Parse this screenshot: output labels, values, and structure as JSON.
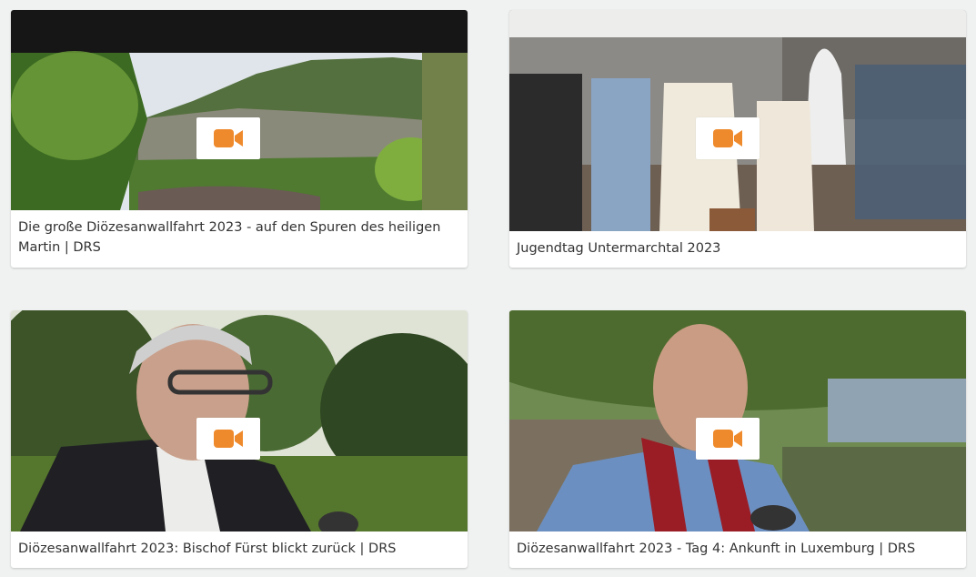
{
  "colors": {
    "page_background": "#f0f1f1",
    "card_background": "#ffffff",
    "accent_icon": "#ef8a2c",
    "caption_text": "#333333"
  },
  "videos": [
    {
      "title": "Die große Diözesanwallfahrt 2023 - auf den Spuren des heiligen Martin | DRS",
      "icon": "video-camera-icon"
    },
    {
      "title": "Jugendtag Untermarchtal 2023",
      "icon": "video-camera-icon"
    },
    {
      "title": "Diözesanwallfahrt 2023: Bischof Fürst blickt zurück | DRS",
      "icon": "video-camera-icon"
    },
    {
      "title": "Diözesanwallfahrt 2023 - Tag 4: Ankunft in Luxemburg | DRS",
      "icon": "video-camera-icon"
    }
  ]
}
